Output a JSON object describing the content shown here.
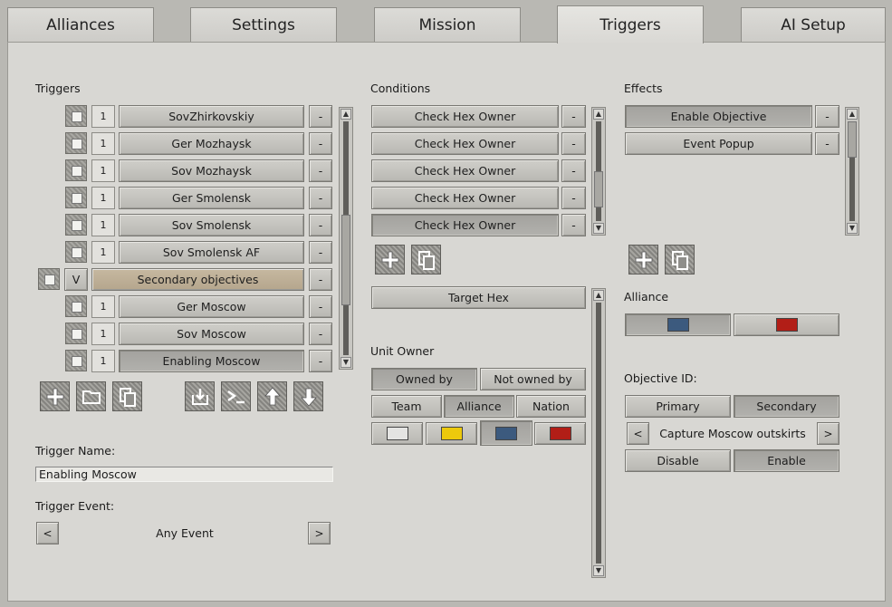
{
  "tabs": [
    "Alliances",
    "Settings",
    "Mission",
    "Triggers",
    "AI Setup"
  ],
  "triggers": {
    "heading": "Triggers",
    "rows": [
      {
        "checkbox": "",
        "num": "1",
        "name": "SovZhirkovskiy",
        "dash": "-"
      },
      {
        "checkbox": "",
        "num": "1",
        "name": "Ger Mozhaysk",
        "dash": "-"
      },
      {
        "checkbox": "",
        "num": "1",
        "name": "Sov Mozhaysk",
        "dash": "-"
      },
      {
        "checkbox": "",
        "num": "1",
        "name": "Ger Smolensk",
        "dash": "-"
      },
      {
        "checkbox": "",
        "num": "1",
        "name": "Sov Smolensk",
        "dash": "-"
      },
      {
        "checkbox": "",
        "num": "1",
        "name": "Sov Smolensk AF",
        "dash": "-"
      },
      {
        "checkbox": "",
        "num": "V",
        "name": "Secondary objectives",
        "dash": "-"
      },
      {
        "checkbox": "",
        "num": "1",
        "name": "Ger Moscow",
        "dash": "-"
      },
      {
        "checkbox": "",
        "num": "1",
        "name": "Sov Moscow",
        "dash": "-"
      },
      {
        "checkbox": "",
        "num": "1",
        "name": "Enabling Moscow",
        "dash": "-"
      }
    ],
    "tools": [
      "plus-icon",
      "folder-icon",
      "copy-icon",
      "import-icon",
      "console-icon",
      "arrow-up-icon",
      "arrow-down-icon"
    ],
    "name_label": "Trigger Name:",
    "name_value": "Enabling Moscow",
    "event_label": "Trigger Event:",
    "event_value": "Any Event",
    "prev": "<",
    "next": ">"
  },
  "conditions": {
    "heading": "Conditions",
    "rows": [
      "Check Hex Owner",
      "Check Hex Owner",
      "Check Hex Owner",
      "Check Hex Owner",
      "Check Hex Owner"
    ],
    "dash": "-",
    "target_hex": "Target Hex",
    "unit_owner_label": "Unit Owner",
    "owned_by": "Owned by",
    "not_owned_by": "Not owned by",
    "team": "Team",
    "alliance": "Alliance",
    "nation": "Nation",
    "colors": [
      "#e4e4e2",
      "#ecc90c",
      "#3c5a7e",
      "#b21e17"
    ]
  },
  "effects": {
    "heading": "Effects",
    "rows": [
      "Enable Objective",
      "Event Popup"
    ],
    "dash": "-",
    "alliance_label": "Alliance",
    "alliance_colors": [
      "#3c5a7e",
      "#b21e17"
    ],
    "objective_label": "Objective ID:",
    "primary": "Primary",
    "secondary": "Secondary",
    "objective_value": "Capture Moscow outskirts",
    "prev": "<",
    "next": ">",
    "disable": "Disable",
    "enable": "Enable"
  }
}
